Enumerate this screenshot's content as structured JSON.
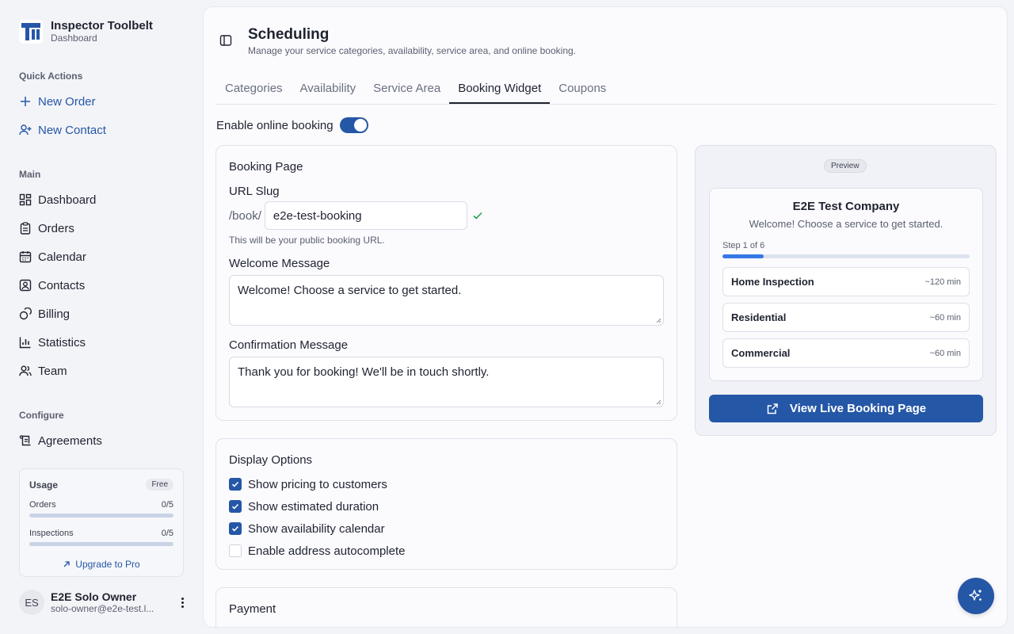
{
  "app": {
    "name": "Inspector Toolbelt",
    "subtitle": "Dashboard"
  },
  "sidebar": {
    "quick_actions_label": "Quick Actions",
    "quick_actions": [
      {
        "label": "New Order",
        "icon": "plus-icon"
      },
      {
        "label": "New Contact",
        "icon": "user-plus-icon"
      }
    ],
    "main_label": "Main",
    "main_items": [
      {
        "label": "Dashboard",
        "icon": "grid-icon"
      },
      {
        "label": "Orders",
        "icon": "clipboard-icon"
      },
      {
        "label": "Calendar",
        "icon": "calendar-icon"
      },
      {
        "label": "Contacts",
        "icon": "contact-card-icon"
      },
      {
        "label": "Billing",
        "icon": "coins-icon"
      },
      {
        "label": "Statistics",
        "icon": "bar-chart-icon"
      },
      {
        "label": "Team",
        "icon": "users-icon"
      }
    ],
    "configure_label": "Configure",
    "configure_items": [
      {
        "label": "Agreements",
        "icon": "scroll-icon"
      }
    ],
    "usage": {
      "title": "Usage",
      "plan": "Free",
      "rows": [
        {
          "label": "Orders",
          "value": "0/5",
          "fraction": 0
        },
        {
          "label": "Inspections",
          "value": "0/5",
          "fraction": 0
        }
      ],
      "upgrade_label": "Upgrade to Pro"
    },
    "user": {
      "initials": "ES",
      "name": "E2E Solo Owner",
      "email": "solo-owner@e2e-test.l..."
    }
  },
  "header": {
    "title": "Scheduling",
    "subtitle": "Manage your service categories, availability, service area, and online booking."
  },
  "tabs": [
    {
      "label": "Categories",
      "active": false
    },
    {
      "label": "Availability",
      "active": false
    },
    {
      "label": "Service Area",
      "active": false
    },
    {
      "label": "Booking Widget",
      "active": true
    },
    {
      "label": "Coupons",
      "active": false
    }
  ],
  "enable_booking": {
    "label": "Enable online booking",
    "on": true
  },
  "booking_page": {
    "title": "Booking Page",
    "slug_label": "URL Slug",
    "slug_prefix": "/book/",
    "slug_value": "e2e-test-booking",
    "slug_helper": "This will be your public booking URL.",
    "welcome_label": "Welcome Message",
    "welcome_value": "Welcome! Choose a service to get started.",
    "confirmation_label": "Confirmation Message",
    "confirmation_value": "Thank you for booking! We'll be in touch shortly."
  },
  "display_options": {
    "title": "Display Options",
    "options": [
      {
        "label": "Show pricing to customers",
        "checked": true
      },
      {
        "label": "Show estimated duration",
        "checked": true
      },
      {
        "label": "Show availability calendar",
        "checked": true
      },
      {
        "label": "Enable address autocomplete",
        "checked": false
      }
    ]
  },
  "payment": {
    "title": "Payment"
  },
  "preview": {
    "badge": "Preview",
    "company": "E2E Test Company",
    "welcome": "Welcome! Choose a service to get started.",
    "step": "Step 1 of 6",
    "step_fraction": 0.1667,
    "services": [
      {
        "name": "Home Inspection",
        "duration": "~120 min"
      },
      {
        "name": "Residential",
        "duration": "~60 min"
      },
      {
        "name": "Commercial",
        "duration": "~60 min"
      }
    ],
    "live_button": "View Live Booking Page"
  },
  "colors": {
    "accent": "#2557a7",
    "progress": "#3578e5",
    "check": "#22a34a"
  }
}
